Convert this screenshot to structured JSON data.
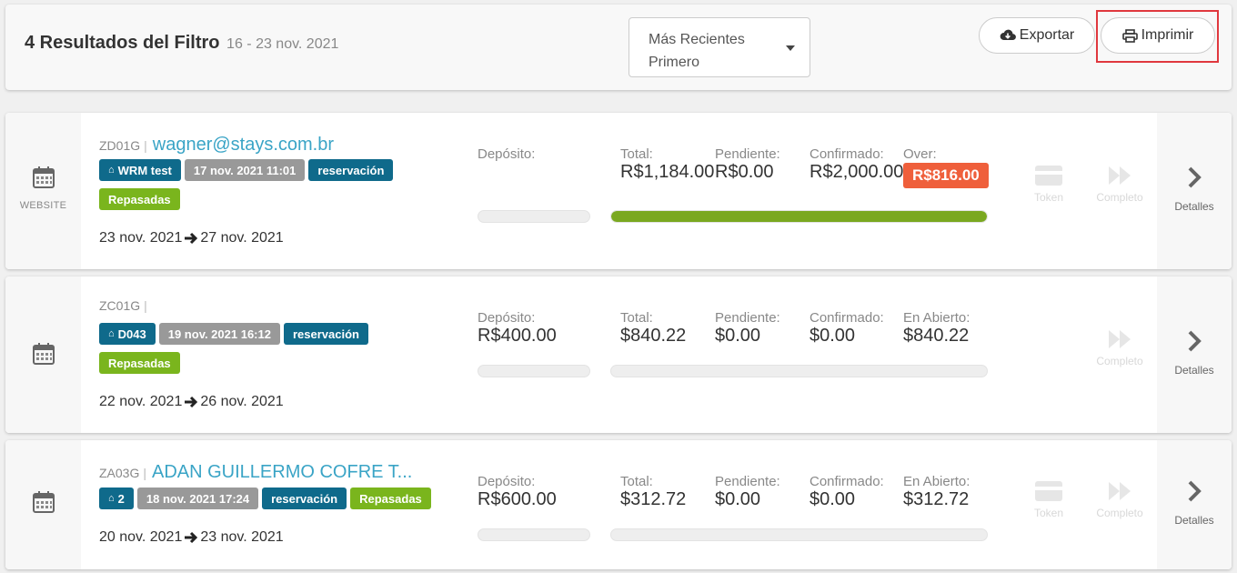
{
  "header": {
    "title": "4 Resultados del Filtro",
    "date_range": "16 - 23 nov. 2021",
    "sort_value": "Más Recientes Primero",
    "export_label": "Exportar",
    "print_label": "Imprimir"
  },
  "labels": {
    "deposit": "Depósito:",
    "total": "Total:",
    "pending": "Pendiente:",
    "confirmed": "Confirmado:",
    "over": "Over:",
    "open": "En Abierto:",
    "token": "Token",
    "complete": "Completo",
    "details": "Detalles"
  },
  "reservations": [
    {
      "code": "ZD01G",
      "sep": "|",
      "guest": "wagner@stays.com.br",
      "source": "WEBSITE",
      "tags": {
        "listing": "WRM test",
        "created": "17 nov. 2021 11:01",
        "type": "reservación",
        "status": "Repasadas"
      },
      "checkin": "23 nov. 2021",
      "checkout": "27 nov. 2021",
      "deposit": "",
      "total": "R$1,184.00",
      "pending": "R$0.00",
      "confirmed": "R$2,000.00",
      "over": "R$816.00",
      "payment_progress": 1.0
    },
    {
      "code": "ZC01G",
      "sep": "|",
      "guest": "",
      "source": "",
      "tags": {
        "listing": "D043",
        "created": "19 nov. 2021 16:12",
        "type": "reservación",
        "status": "Repasadas"
      },
      "checkin": "22 nov. 2021",
      "checkout": "26 nov. 2021",
      "deposit": "R$400.00",
      "total": "$840.22",
      "pending": "$0.00",
      "confirmed": "$0.00",
      "open": "$840.22",
      "payment_progress": 0
    },
    {
      "code": "ZA03G",
      "sep": "|",
      "guest": "ADAN GUILLERMO COFRE T...",
      "source": "",
      "tags": {
        "listing": "2",
        "created": "18 nov. 2021 17:24",
        "type": "reservación",
        "status": "Repasadas"
      },
      "checkin": "20 nov. 2021",
      "checkout": "23 nov. 2021",
      "deposit": "R$600.00",
      "total": "$312.72",
      "pending": "$0.00",
      "confirmed": "$0.00",
      "open": "$312.72",
      "payment_progress": 0
    }
  ],
  "colors": {
    "accent": "#3aa4c6",
    "tag_blue": "#0f6a8b",
    "tag_green": "#7ab51d",
    "over_badge": "#ef5f3b",
    "highlight": "#e0383e"
  }
}
